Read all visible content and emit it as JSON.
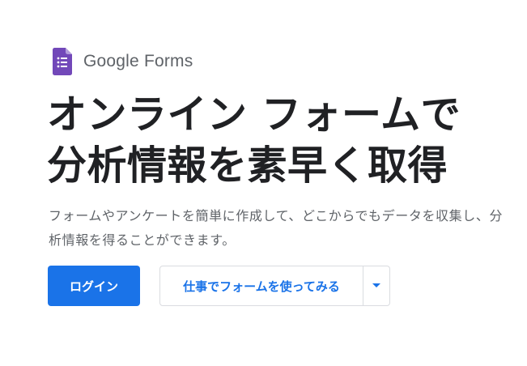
{
  "brand": {
    "name": "Google Forms",
    "icon": "google-forms-icon",
    "icon_color": "#7248b9"
  },
  "hero": {
    "headline_line1": "オンライン フォームで",
    "headline_line2": "分析情報を素早く取得",
    "description": "フォームやアンケートを簡単に作成して、どこからでもデータを収集し、分析情報を得ることができます。"
  },
  "actions": {
    "login_label": "ログイン",
    "work_label": "仕事でフォームを使ってみる",
    "dropdown_icon": "caret-down-icon"
  },
  "colors": {
    "primary": "#1a73e8",
    "heading": "#202124",
    "secondary_text": "#5f6368",
    "border": "#dadce0"
  }
}
